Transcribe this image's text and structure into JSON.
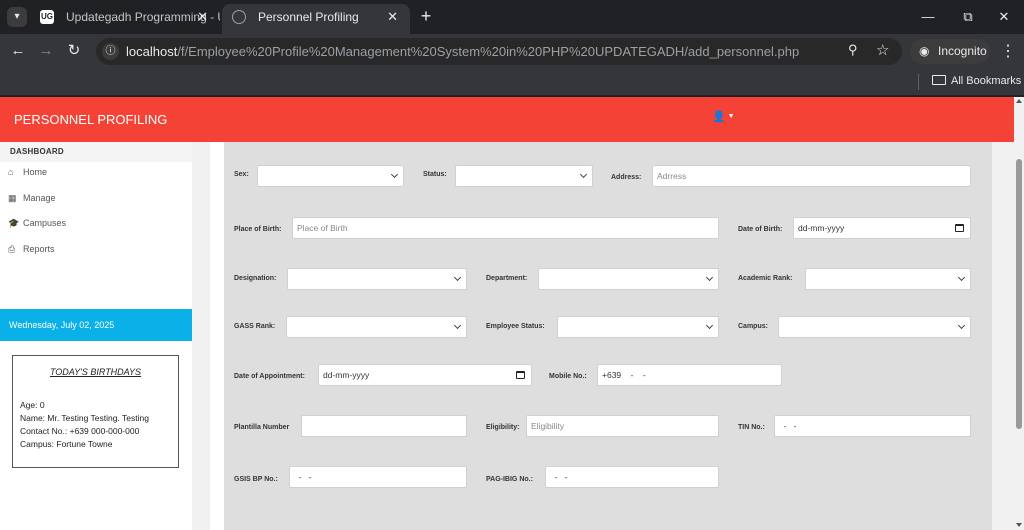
{
  "browser": {
    "tabs": [
      {
        "title": "Updategadh Programming - Up",
        "favicon": "UG"
      },
      {
        "title": "Personnel Profiling",
        "favicon": "globe-icon"
      }
    ],
    "url_host": "localhost",
    "url_path": "/f/Employee%20Profile%20Management%20System%20in%20PHP%20UPDATEGADH/add_personnel.php",
    "incognito_label": "Incognito",
    "all_bookmarks_label": "All Bookmarks"
  },
  "header": {
    "brand": "PERSONNEL PROFILING",
    "accent_color": "#f44336"
  },
  "sidebar": {
    "dashboard_title": "DASHBOARD",
    "items": [
      {
        "label": "Home",
        "icon": "home-icon"
      },
      {
        "label": "Manage",
        "icon": "grid-icon"
      },
      {
        "label": "Campuses",
        "icon": "graduation-cap-icon"
      },
      {
        "label": "Reports",
        "icon": "print-icon"
      }
    ],
    "date": "Wednesday, July 02, 2025",
    "birthdays": {
      "title": "TODAY'S BIRTHDAYS",
      "age": "Age: 0",
      "name": "Name: Mr. Testing Testing. Testing",
      "contact": "Contact No.: +639 000-000-000",
      "campus": "Campus: Fortune Towne"
    }
  },
  "form": {
    "sex": {
      "label": "Sex:",
      "value": ""
    },
    "status": {
      "label": "Status:",
      "value": ""
    },
    "address": {
      "label": "Address:",
      "placeholder": "Adrress"
    },
    "place_of_birth": {
      "label": "Place of Birth:",
      "placeholder": "Place of Birth"
    },
    "date_of_birth": {
      "label": "Date of Birth:",
      "value": "dd-mm-yyyy"
    },
    "designation": {
      "label": "Designation:",
      "value": ""
    },
    "department": {
      "label": "Department:",
      "value": ""
    },
    "academic_rank": {
      "label": "Academic Rank:",
      "value": ""
    },
    "gass_rank": {
      "label": "GASS Rank:",
      "value": ""
    },
    "employee_status": {
      "label": "Employee Status:",
      "value": ""
    },
    "campus": {
      "label": "Campus:",
      "value": ""
    },
    "date_of_appointment": {
      "label": "Date of Appointment:",
      "value": "dd-mm-yyyy"
    },
    "mobile_no": {
      "label": "Mobile No.:",
      "value": "+639    -    -"
    },
    "plantilla_number": {
      "label": "Plantilla Number",
      "value": ""
    },
    "eligibility": {
      "label": "Eligibility:",
      "placeholder": "Eligibility"
    },
    "tin_no": {
      "label": "TIN No.:",
      "value": "  -   -"
    },
    "gsis_bp_no": {
      "label": "GSIS BP No.:",
      "value": "  -   -"
    },
    "pag_ibig_no": {
      "label": "PAG-IBIG No.:",
      "value": "  -   -"
    }
  }
}
